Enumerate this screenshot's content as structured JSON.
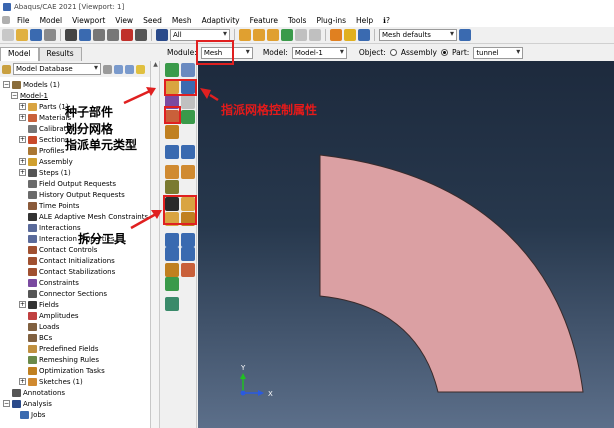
{
  "window": {
    "title": "Abaqus/CAE 2021 [Viewport: 1]"
  },
  "menu": [
    {
      "key": "file",
      "label": "File"
    },
    {
      "key": "model",
      "label": "Model"
    },
    {
      "key": "viewport",
      "label": "Viewport"
    },
    {
      "key": "view",
      "label": "View"
    },
    {
      "key": "seed",
      "label": "Seed"
    },
    {
      "key": "mesh",
      "label": "Mesh"
    },
    {
      "key": "adaptivity",
      "label": "Adaptivity"
    },
    {
      "key": "feature",
      "label": "Feature"
    },
    {
      "key": "tools",
      "label": "Tools"
    },
    {
      "key": "plugins",
      "label": "Plug-ins"
    },
    {
      "key": "help",
      "label": "Help"
    },
    {
      "key": "whatsthis",
      "label": "ℹ?"
    }
  ],
  "toolbar": {
    "selection_filter": "All",
    "mesh_defaults": "Mesh defaults"
  },
  "tabs": {
    "model": "Model",
    "results": "Results"
  },
  "model_database": {
    "label": "Model Database"
  },
  "module_bar": {
    "module_label": "Module:",
    "module_value": "Mesh",
    "model_label": "Model:",
    "model_value": "Model-1",
    "object_label": "Object:",
    "assembly_label": "Assembly",
    "part_label": "Part:",
    "part_value": "tunnel"
  },
  "tree": [
    {
      "id": "models",
      "label": "Models (1)",
      "level": 0,
      "exp": "−",
      "icon": "#8a6d3b"
    },
    {
      "id": "model1",
      "label": "Model-1",
      "level": 1,
      "exp": "−",
      "icon": ""
    },
    {
      "id": "parts",
      "label": "Parts (1)",
      "level": 2,
      "exp": "+",
      "icon": "#d9a441"
    },
    {
      "id": "materials",
      "label": "Materials",
      "level": 2,
      "exp": "+",
      "icon": "#c9603a"
    },
    {
      "id": "calibrations",
      "label": "Calibrations",
      "level": 2,
      "exp": "",
      "icon": "#777777"
    },
    {
      "id": "sections",
      "label": "Sections",
      "level": 2,
      "exp": "+",
      "icon": "#c94a2a"
    },
    {
      "id": "profiles",
      "label": "Profiles",
      "level": 2,
      "exp": "",
      "icon": "#aa7733"
    },
    {
      "id": "assembly",
      "label": "Assembly",
      "level": 2,
      "exp": "+",
      "icon": "#d0a030"
    },
    {
      "id": "steps",
      "label": "Steps (1)",
      "level": 2,
      "exp": "+",
      "icon": "#555555"
    },
    {
      "id": "fieldout",
      "label": "Field Output Requests",
      "level": 2,
      "exp": "",
      "icon": "#6a6a6a"
    },
    {
      "id": "histout",
      "label": "History Output Requests",
      "level": 2,
      "exp": "",
      "icon": "#6a6a6a"
    },
    {
      "id": "timepoints",
      "label": "Time Points",
      "level": 2,
      "exp": "",
      "icon": "#8a5a3a"
    },
    {
      "id": "alemesh",
      "label": "ALE Adaptive Mesh Constraints",
      "level": 2,
      "exp": "",
      "icon": "#333333"
    },
    {
      "id": "interactions",
      "label": "Interactions",
      "level": 2,
      "exp": "",
      "icon": "#5a6a9a"
    },
    {
      "id": "intprops",
      "label": "Interaction Properties",
      "level": 2,
      "exp": "",
      "icon": "#5a6a9a"
    },
    {
      "id": "contactctrl",
      "label": "Contact Controls",
      "level": 2,
      "exp": "",
      "icon": "#a05030"
    },
    {
      "id": "contactinit",
      "label": "Contact Initializations",
      "level": 2,
      "exp": "",
      "icon": "#a05030"
    },
    {
      "id": "contactstab",
      "label": "Contact Stabilizations",
      "level": 2,
      "exp": "",
      "icon": "#a05030"
    },
    {
      "id": "constraints",
      "label": "Constraints",
      "level": 2,
      "exp": "",
      "icon": "#7a4aa0"
    },
    {
      "id": "connsec",
      "label": "Connector Sections",
      "level": 2,
      "exp": "",
      "icon": "#555555"
    },
    {
      "id": "fields",
      "label": "Fields",
      "level": 2,
      "exp": "+",
      "icon": "#333333"
    },
    {
      "id": "amplitudes",
      "label": "Amplitudes",
      "level": 2,
      "exp": "",
      "icon": "#c04040"
    },
    {
      "id": "loads",
      "label": "Loads",
      "level": 2,
      "exp": "",
      "icon": "#806040"
    },
    {
      "id": "bcs",
      "label": "BCs",
      "level": 2,
      "exp": "",
      "icon": "#806040"
    },
    {
      "id": "predef",
      "label": "Predefined Fields",
      "level": 2,
      "exp": "",
      "icon": "#c09040"
    },
    {
      "id": "remesh",
      "label": "Remeshing Rules",
      "level": 2,
      "exp": "",
      "icon": "#6a8a4a"
    },
    {
      "id": "opttasks",
      "label": "Optimization Tasks",
      "level": 2,
      "exp": "",
      "icon": "#c08020"
    },
    {
      "id": "sketches",
      "label": "Sketches (1)",
      "level": 2,
      "exp": "+",
      "icon": "#d08a30"
    },
    {
      "id": "annotations",
      "label": "Annotations",
      "level": 0,
      "exp": "",
      "icon": "#555555"
    },
    {
      "id": "analysis",
      "label": "Analysis",
      "level": 0,
      "exp": "−",
      "icon": "#2a4a8a"
    },
    {
      "id": "jobs",
      "label": "Jobs",
      "level": 1,
      "exp": "",
      "icon": "#3a6ab0"
    }
  ],
  "annotations": {
    "seed_part": "种子部件",
    "mesh_part": "划分网格",
    "assign_element": "指派单元类型",
    "mesh_controls": "指派网格控制属性",
    "partition_tools": "拆分工具"
  },
  "colors": {
    "part_fill": "#dba0a3",
    "annotation_red": "#e02020"
  },
  "axes": {
    "x": "X",
    "y": "Y"
  }
}
